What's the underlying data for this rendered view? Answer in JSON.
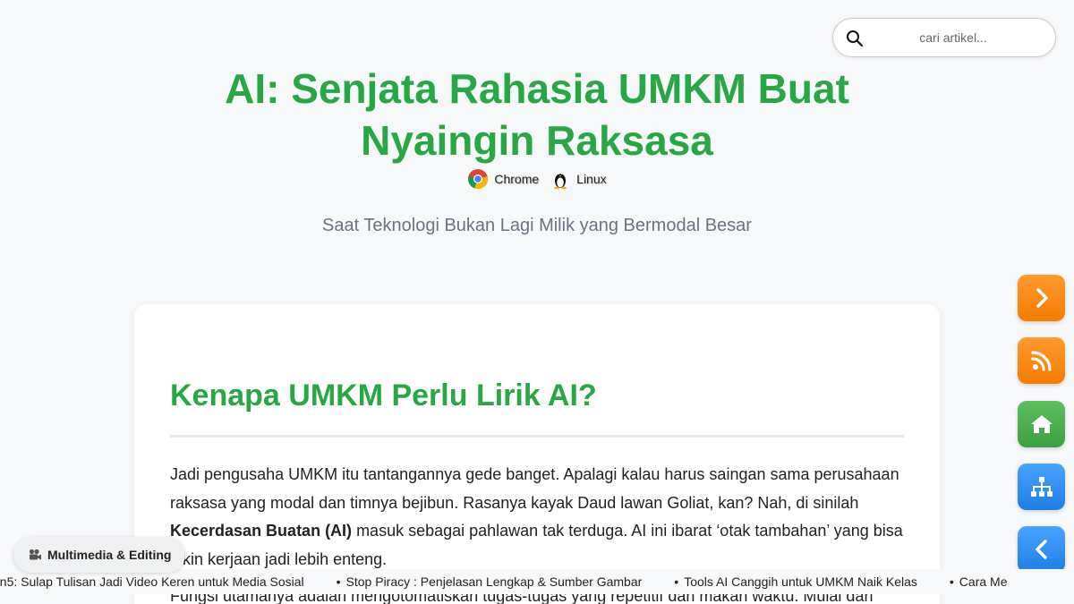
{
  "search": {
    "placeholder": "cari artikel..."
  },
  "header": {
    "title": "AI: Senjata Rahasia UMKM Buat Nyaingin Raksasa",
    "badges": [
      {
        "label": "Chrome",
        "icon": "chrome-icon"
      },
      {
        "label": "Linux",
        "icon": "linux-icon"
      }
    ],
    "subtitle": "Saat Teknologi Bukan Lagi Milik yang Bermodal Besar"
  },
  "article": {
    "section_heading": "Kenapa UMKM Perlu Lirik AI?",
    "para1_part1": "Jadi pengusaha UMKM itu tantangannya gede banget. Apalagi kalau harus saingan sama perusahaan raksasa yang modal dan timnya bejibun. Rasanya kayak Daud lawan Goliat, kan? Nah, di sinilah ",
    "para1_bold": "Kecerdasan Buatan (AI)",
    "para1_part2": " masuk sebagai pahlawan tak terduga. AI ini ibarat ‘otak tambahan’ yang bisa bikin kerjaan jadi lebih enteng.",
    "para2": "Fungsi utamanya adalah mengotomatiskan tugas-tugas yang repetitif dan makan waktu. Mulai dari"
  },
  "side_buttons": [
    {
      "name": "next-button",
      "icon": "chevron-right-icon",
      "color": "#f57c00"
    },
    {
      "name": "rss-button",
      "icon": "rss-icon",
      "color": "#f57c00"
    },
    {
      "name": "home-button",
      "icon": "home-icon",
      "color": "#3e9f42"
    },
    {
      "name": "sitemap-button",
      "icon": "sitemap-icon",
      "color": "#1e7ee6"
    },
    {
      "name": "back-button",
      "icon": "chevron-left-icon",
      "color": "#1e7ee6"
    }
  ],
  "category_chip": {
    "label": "Multimedia & Editing",
    "icon": "camera-icon"
  },
  "ticker": {
    "items": [
      "en5: Sulap Tulisan Jadi Video Keren untuk Media Sosial",
      "Stop Piracy : Penjelasan Lengkap & Sumber Gambar",
      "Tools AI Canggih untuk UMKM Naik Kelas",
      "Cara Me"
    ]
  },
  "colors": {
    "accent_green": "#28a745",
    "orange": "#f57c00",
    "blue": "#1e7ee6",
    "green_button": "#3e9f42"
  }
}
